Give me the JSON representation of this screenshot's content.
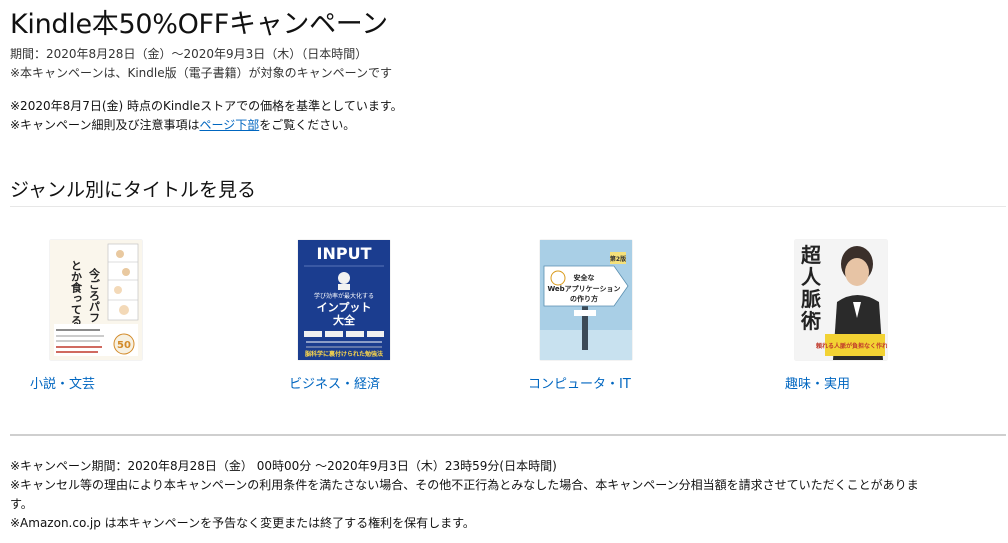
{
  "header": {
    "title": "Kindle本50%OFFキャンペーン",
    "period": "期間：2020年8月28日（金）〜2020年9月3日（木）（日本時間）",
    "target": "※本キャンペーンは、Kindle版（電子書籍）が対象のキャンペーンです"
  },
  "notes": {
    "price_basis": "※2020年8月7日(金) 時点のKindleストアでの価格を基準としています。",
    "details_prefix": "※キャンペーン細則及び注意事項は",
    "details_link": "ページ下部",
    "details_suffix": "をご覧ください。"
  },
  "section": {
    "title": "ジャンル別にタイトルを見る"
  },
  "genres": [
    {
      "label": "小説・文芸"
    },
    {
      "label": "ビジネス・経済"
    },
    {
      "label": "コンピュータ・IT"
    },
    {
      "label": "趣味・実用"
    }
  ],
  "covers": {
    "book1": {
      "line1": "今ごろパフェ",
      "line2": "とか食ってるよ。",
      "badge": "50"
    },
    "book2": {
      "brand": "INPUT",
      "sub": "学び効率が最大化する",
      "main1": "インプット",
      "main2": "大全",
      "foot": "脳科学に裏付けられた勉強法"
    },
    "book3": {
      "badge": "第2版",
      "line1": "安全な",
      "line2": "Webアプリケーション",
      "line3": "の作り方"
    },
    "book4": {
      "c1": "超",
      "c2": "人",
      "c3": "脈",
      "c4": "術",
      "band": "頼れる人脈が負担なく作れる"
    }
  },
  "footer": {
    "period": "※キャンペーン期間：2020年8月28日（金） 00時00分 〜2020年9月3日（木）23時59分(日本時間)",
    "cancel1": "※キャンセル等の理由により本キャンペーンの利用条件を満たさない場合、その他不正行為とみなした場合、本キャンペーン分相当額を請求させていただくことがありま",
    "cancel2": "す。",
    "rights": "※Amazon.co.jp は本キャンペーンを予告なく変更または終了する権利を保有します。"
  }
}
